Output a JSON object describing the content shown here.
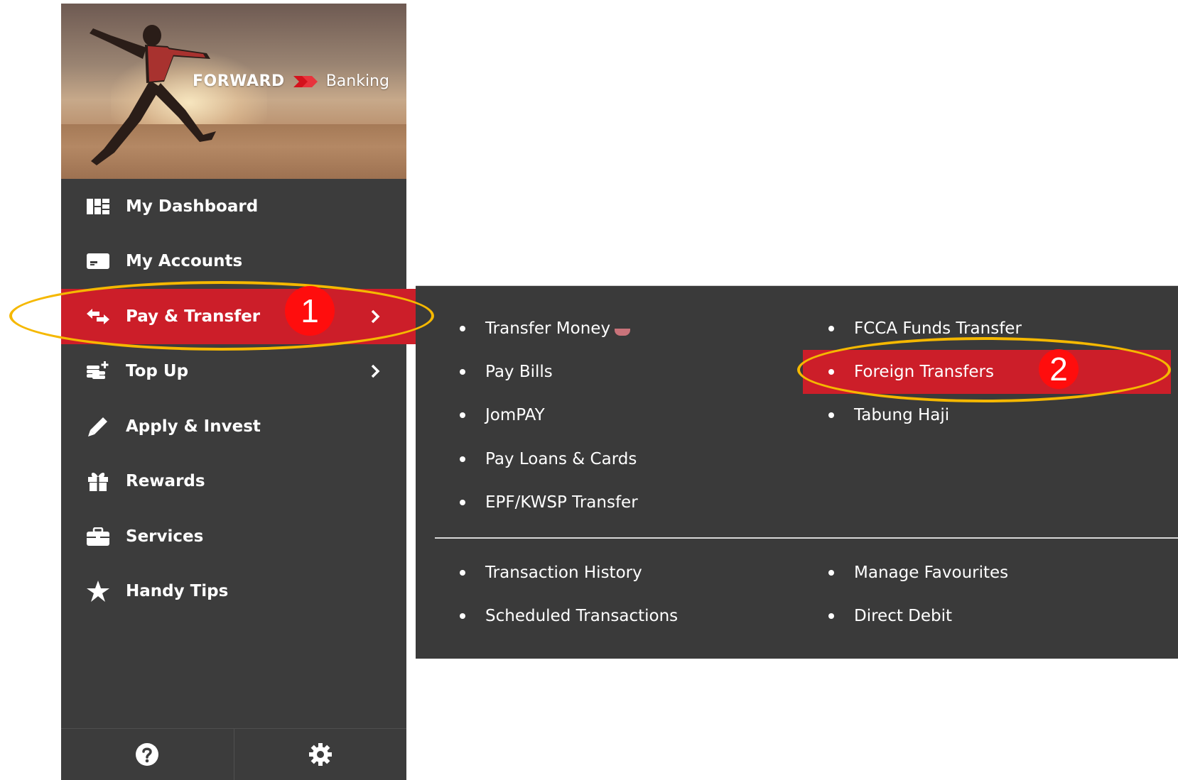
{
  "banner": {
    "brand_forward": "FORWARD",
    "brand_banking": "Banking"
  },
  "nav": {
    "items": [
      {
        "label": "My Dashboard",
        "icon": "dashboard-icon"
      },
      {
        "label": "My Accounts",
        "icon": "card-icon"
      },
      {
        "label": "Pay & Transfer",
        "icon": "transfer-arrows-icon",
        "active": true,
        "has_submenu": true
      },
      {
        "label": "Top Up",
        "icon": "coins-plus-icon",
        "has_submenu": true
      },
      {
        "label": "Apply & Invest",
        "icon": "pencil-icon"
      },
      {
        "label": "Rewards",
        "icon": "gift-icon"
      },
      {
        "label": "Services",
        "icon": "briefcase-icon"
      },
      {
        "label": "Handy Tips",
        "icon": "star-icon"
      }
    ]
  },
  "footer": {
    "help_icon": "help-icon",
    "settings_icon": "gear-icon"
  },
  "submenu": {
    "left_column": [
      "Transfer Money",
      "Pay Bills",
      "JomPAY",
      "Pay Loans & Cards",
      "EPF/KWSP Transfer"
    ],
    "right_column": [
      "FCCA Funds Transfer",
      "Foreign Transfers",
      "Tabung Haji"
    ],
    "bottom_left": [
      "Transaction History",
      "Scheduled Transactions"
    ],
    "bottom_right": [
      "Manage Favourites",
      "Direct Debit"
    ],
    "highlighted": "Foreign Transfers"
  },
  "annotations": {
    "step1": "1",
    "step2": "2"
  },
  "colors": {
    "accent_red": "#cc1e29",
    "sidebar_bg": "#3c3c3c",
    "ring_yellow": "#f5b800",
    "badge_red": "#ff0d0d"
  }
}
